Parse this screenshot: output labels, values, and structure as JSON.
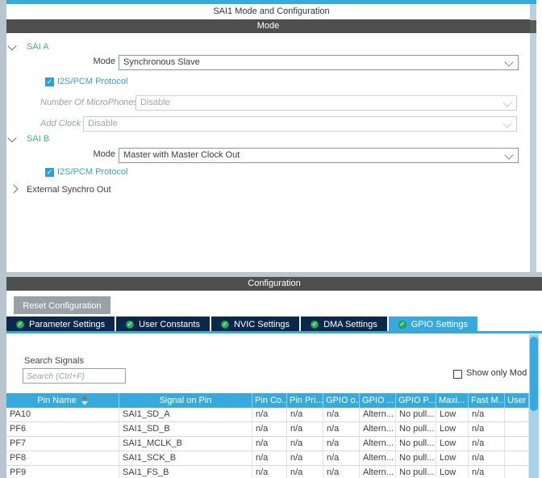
{
  "window": {
    "title": "SAI1 Mode and Configuration"
  },
  "mode_panel": {
    "header": "Mode",
    "sai_a": {
      "label": "SAI A",
      "mode_label": "Mode",
      "mode_value": "Synchronous Slave",
      "protocol_label": "I2S/PCM Protocol",
      "protocol_checked": true,
      "microphones_label": "Number Of MicroPhones",
      "microphones_value": "Disable",
      "add_clock_label": "Add Clock",
      "add_clock_value": "Disable"
    },
    "sai_b": {
      "label": "SAI B",
      "mode_label": "Mode",
      "mode_value": "Master with Master Clock Out",
      "protocol_label": "I2S/PCM Protocol",
      "protocol_checked": true
    },
    "external_synchro": {
      "label": "External Synchro Out"
    }
  },
  "config_panel": {
    "header": "Configuration",
    "reset_button": "Reset Configuration",
    "tabs": [
      {
        "label": "Parameter Settings",
        "active": false
      },
      {
        "label": "User Constants",
        "active": false
      },
      {
        "label": "NVIC Settings",
        "active": false
      },
      {
        "label": "DMA Settings",
        "active": false
      },
      {
        "label": "GPIO Settings",
        "active": true
      }
    ],
    "search_label": "Search Signals",
    "search_placeholder": "Search (Ctrl+F)",
    "show_only_label": "Show only Mod",
    "show_only_checked": false,
    "table": {
      "sort": {
        "column": "Pin Name",
        "direction": "asc"
      },
      "columns": [
        "Pin Name",
        "Signal on Pin",
        "Pin Co...",
        "Pin Pri...",
        "GPIO o...",
        "GPIO ...",
        "GPIO P...",
        "Maxi...",
        "Fast M...",
        "User"
      ],
      "rows": [
        [
          "PA10",
          "SAI1_SD_A",
          "n/a",
          "n/a",
          "n/a",
          "Altern...",
          "No pull...",
          "Low",
          "n/a",
          ""
        ],
        [
          "PF6",
          "SAI1_SD_B",
          "n/a",
          "n/a",
          "n/a",
          "Altern...",
          "No pull...",
          "Low",
          "n/a",
          ""
        ],
        [
          "PF7",
          "SAI1_MCLK_B",
          "n/a",
          "n/a",
          "n/a",
          "Altern...",
          "No pull...",
          "Low",
          "n/a",
          ""
        ],
        [
          "PF8",
          "SAI1_SCK_B",
          "n/a",
          "n/a",
          "n/a",
          "Altern...",
          "No pull...",
          "Low",
          "n/a",
          ""
        ],
        [
          "PF9",
          "SAI1_FS_B",
          "n/a",
          "n/a",
          "n/a",
          "Altern...",
          "No pull...",
          "Low",
          "n/a",
          ""
        ]
      ]
    }
  },
  "colors": {
    "accent_blue": "#38a9dc",
    "tab_navy": "#0c2848",
    "section_bar_gray": "#4f4f4f",
    "tree_green": "#3cb878",
    "checkbox_blue": "#2f9fd8",
    "button_gray": "#9aa1a4"
  }
}
